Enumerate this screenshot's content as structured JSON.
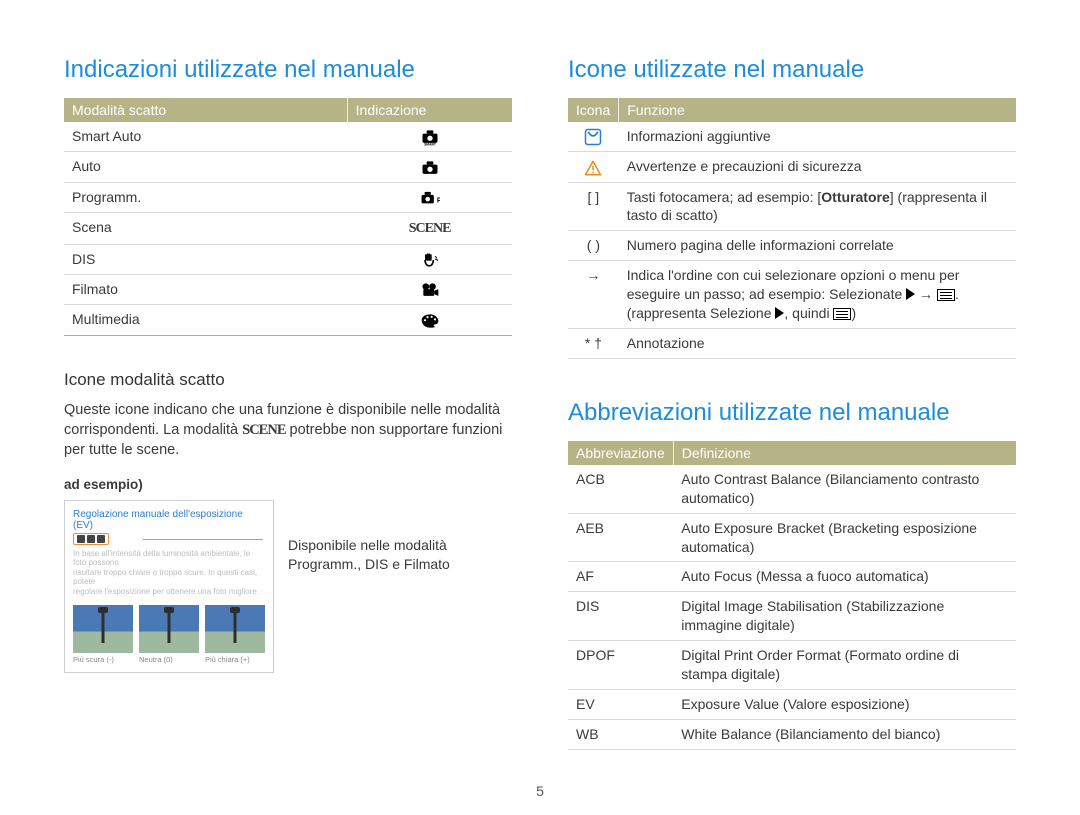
{
  "page_number": "5",
  "left": {
    "title": "Indicazioni utilizzate nel manuale",
    "table": {
      "headers": {
        "mode": "Modalità scatto",
        "ind": "Indicazione"
      },
      "rows": [
        {
          "mode": "Smart Auto",
          "icon": "camera-smart-icon"
        },
        {
          "mode": "Auto",
          "icon": "camera-icon"
        },
        {
          "mode": "Programm.",
          "icon": "camera-p-icon"
        },
        {
          "mode": "Scena",
          "icon": "scene-word-icon"
        },
        {
          "mode": "DIS",
          "icon": "hand-wave-icon"
        },
        {
          "mode": "Filmato",
          "icon": "movie-camera-icon"
        },
        {
          "mode": "Multimedia",
          "icon": "palette-icon"
        }
      ]
    },
    "sub": {
      "heading": "Icone modalità scatto",
      "para_pre": "Queste icone indicano che una funzione è disponibile nelle modalità corrispondenti. La modalità ",
      "para_scene": "SCENE",
      "para_post": " potrebbe non supportare funzioni per tutte le scene.",
      "eg_label": "ad esempio)",
      "example": {
        "title": "Regolazione manuale dell'esposizione (EV)",
        "blur1": "In base all'intensità della luminosità ambientale, le foto possono",
        "blur2": "risultare troppo chiare o troppo scure. In questi casi, potete",
        "blur3": "regolare l'esposizione per ottenere una foto migliore.",
        "caps": [
          "Più scura (-)",
          "Neutra (0)",
          "Più chiara (+)"
        ]
      },
      "note": "Disponibile nelle modalità Programm., DIS e Filmato"
    }
  },
  "right_icons": {
    "title": "Icone utilizzate nel manuale",
    "headers": {
      "icon": "Icona",
      "func": "Funzione"
    },
    "rows": [
      {
        "sym": "info",
        "text": "Informazioni aggiuntive"
      },
      {
        "sym": "warn",
        "text": "Avvertenze e precauzioni di sicurezza"
      },
      {
        "sym": "[ ]",
        "text_pre": "Tasti fotocamera; ad esempio: [",
        "bold": "Otturatore",
        "text_post": "] (rappresenta il tasto di scatto)"
      },
      {
        "sym": "( )",
        "text": "Numero pagina delle informazioni correlate"
      },
      {
        "sym": "→",
        "text_pre": "Indica l'ordine con cui selezionare opzioni o menu per eseguire un passo; ad esempio: Selezionate ",
        "inline_icons": true,
        "text_post": "."
      },
      {
        "sym": "* †",
        "text": "Annotazione"
      }
    ],
    "arrow_caption_pre": "(rappresenta Selezione ",
    "arrow_caption_mid": ", quindi ",
    "arrow_caption_post": ")"
  },
  "right_abbr": {
    "title": "Abbreviazioni utilizzate nel manuale",
    "headers": {
      "abbr": "Abbreviazione",
      "def": "Definizione"
    },
    "rows": [
      {
        "abbr": "ACB",
        "def": "Auto Contrast Balance (Bilanciamento contrasto automatico)"
      },
      {
        "abbr": "AEB",
        "def": "Auto Exposure Bracket (Bracketing esposizione automatica)"
      },
      {
        "abbr": "AF",
        "def": "Auto Focus (Messa a fuoco automatica)"
      },
      {
        "abbr": "DIS",
        "def": "Digital Image Stabilisation (Stabilizzazione immagine digitale)"
      },
      {
        "abbr": "DPOF",
        "def": "Digital Print Order Format (Formato ordine di stampa digitale)"
      },
      {
        "abbr": "EV",
        "def": "Exposure Value (Valore esposizione)"
      },
      {
        "abbr": "WB",
        "def": "White Balance (Bilanciamento del bianco)"
      }
    ]
  }
}
